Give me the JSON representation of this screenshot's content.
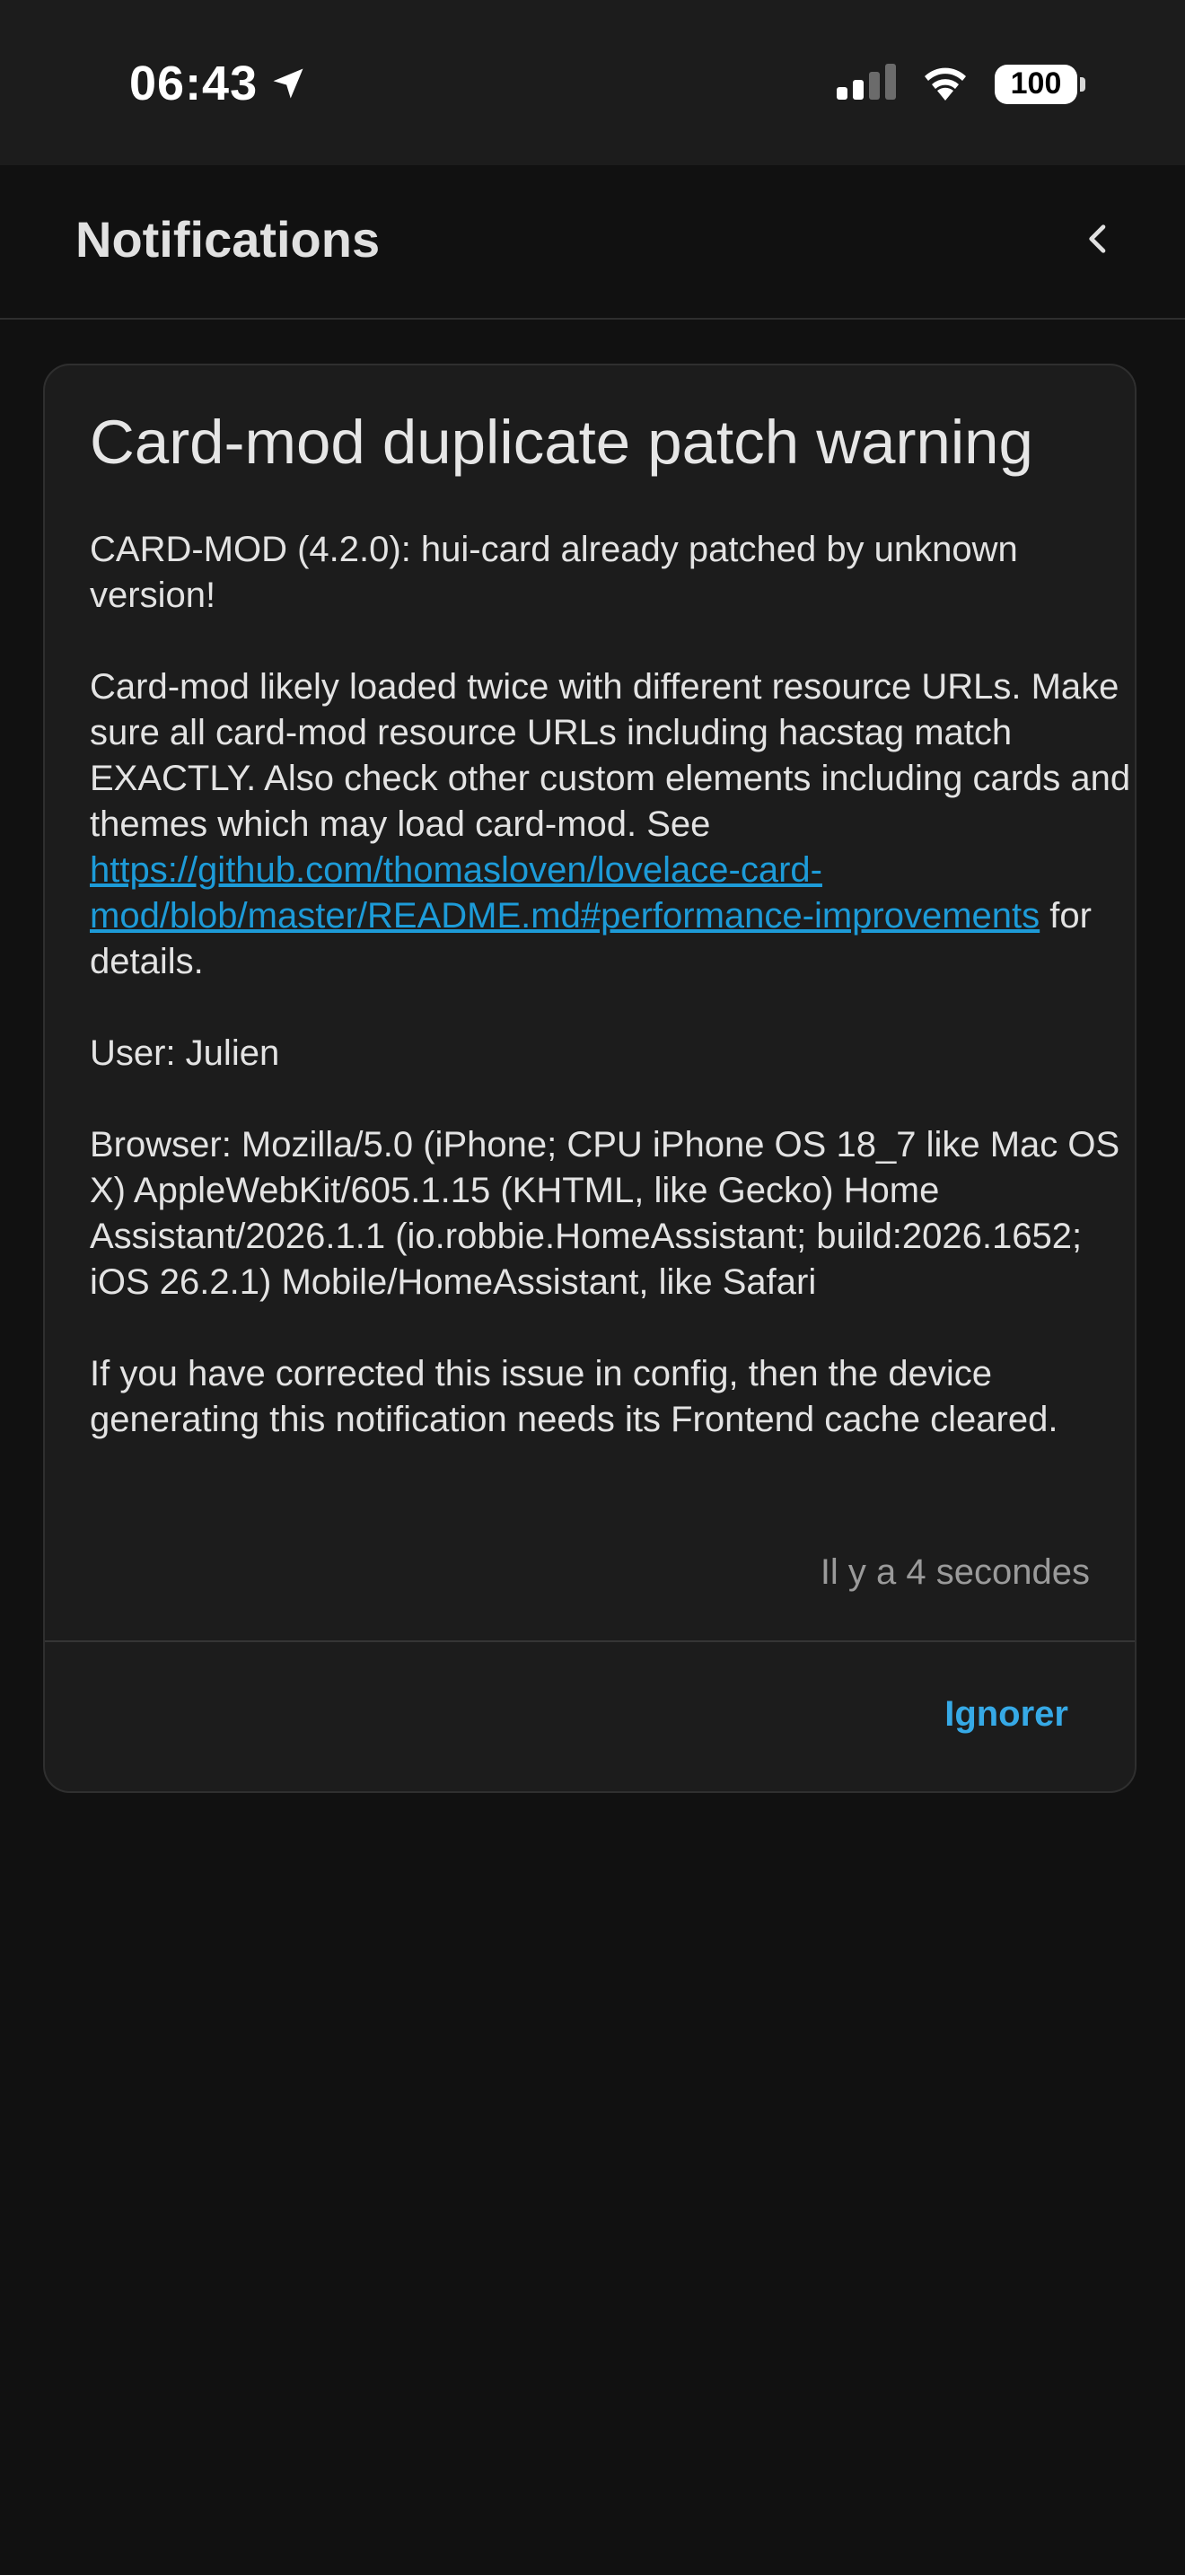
{
  "status_bar": {
    "time": "06:43",
    "battery": "100",
    "icons": [
      "location-arrow-icon",
      "cellular-signal-icon",
      "wifi-icon",
      "battery-icon"
    ]
  },
  "header": {
    "title": "Notifications",
    "back_icon": "chevron-left-icon"
  },
  "notification": {
    "title": "Card-mod duplicate patch warning",
    "line1": "CARD-MOD (4.2.0): hui-card already patched by unknown version!",
    "para2_text": "Card-mod likely loaded twice with different resource URLs. Make sure all card-mod resource URLs including hacstag match EXACTLY. Also check other custom elements including cards and themes which may load card-mod. See",
    "para2_link": "https://github.com/thomasloven/lovelace-card-mod/blob/master/README.md#performance-improvements",
    "para2_suffix": "for details.",
    "user": "User: Julien",
    "browser": "Browser: Mozilla/5.0 (iPhone; CPU iPhone OS 18_7 like Mac OS X) AppleWebKit/605.1.15 (KHTML, like Gecko) Home Assistant/2026.1.1 (io.robbie.HomeAssistant; build:2026.1652; iOS 26.2.1) Mobile/HomeAssistant, like Safari",
    "fix_note": "If you have corrected this issue in config, then the device generating this notification needs its Frontend cache cleared.",
    "timestamp": "Il y a 4 secondes",
    "dismiss_label": "Ignorer"
  },
  "colors": {
    "background": "#111111",
    "card": "#1c1c1c",
    "link": "#1d9bd8",
    "accent": "#36a9e6"
  }
}
